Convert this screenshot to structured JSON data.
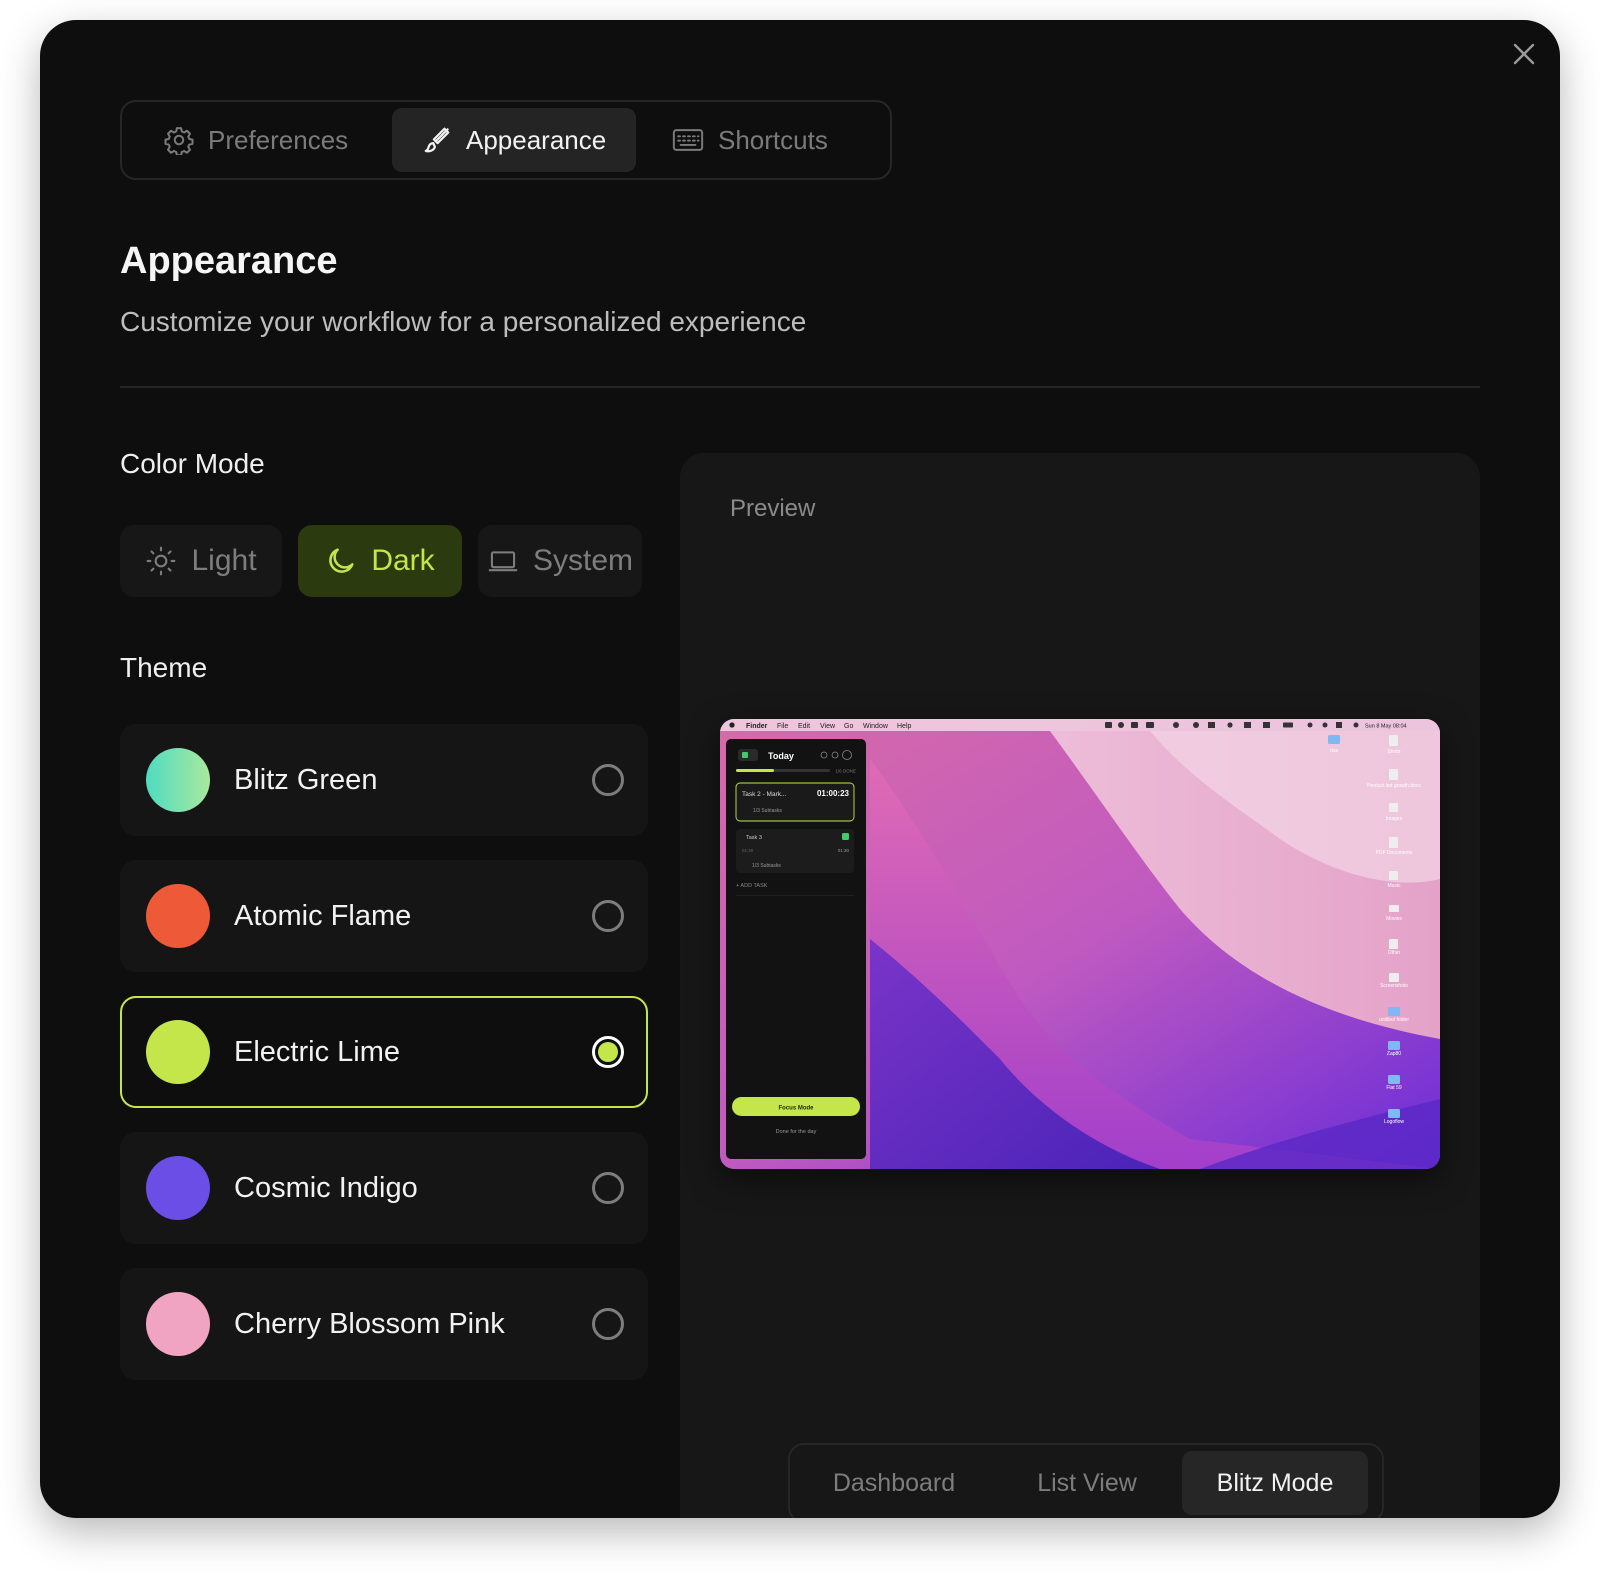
{
  "tabs": [
    {
      "label": "Preferences",
      "icon": "gear-icon"
    },
    {
      "label": "Appearance",
      "icon": "brush-icon"
    },
    {
      "label": "Shortcuts",
      "icon": "keyboard-icon"
    }
  ],
  "active_tab": "Appearance",
  "page": {
    "title": "Appearance",
    "subtitle": "Customize your workflow for a personalized experience"
  },
  "color_mode": {
    "label": "Color Mode",
    "options": [
      {
        "label": "Light",
        "icon": "sun-icon"
      },
      {
        "label": "Dark",
        "icon": "moon-icon"
      },
      {
        "label": "System",
        "icon": "laptop-icon"
      }
    ],
    "selected": "Dark"
  },
  "theme": {
    "label": "Theme",
    "options": [
      {
        "name": "Blitz Green",
        "color": "gradient #5ee0b5 → #a8e6a0"
      },
      {
        "name": "Atomic Flame",
        "color": "#ee5a37"
      },
      {
        "name": "Electric Lime",
        "color": "#c4e64a"
      },
      {
        "name": "Cosmic Indigo",
        "color": "#6b4ee6"
      },
      {
        "name": "Cherry Blossom Pink",
        "color": "#f0a4c2"
      }
    ],
    "selected": "Electric Lime"
  },
  "preview": {
    "label": "Preview",
    "menubar": {
      "items": [
        "Finder",
        "File",
        "Edit",
        "View",
        "Go",
        "Window",
        "Help"
      ],
      "clock": "Sun 8 May 08:04"
    },
    "app": {
      "title": "Today",
      "progress_text": "1/6 DONE",
      "progress": 0.33,
      "tasks": [
        {
          "name": "Task 2 - Mark...",
          "time": "01:00:23",
          "subtasks": "1/3 Subtasks"
        },
        {
          "name": "Task 3",
          "time_left": "01:30",
          "time_right": "01:30",
          "subtasks": "1/3 Subtasks"
        }
      ],
      "add_task": "+ ADD TASK",
      "focus_button": "Focus Mode",
      "done_link": "Done for the day"
    },
    "desktop_icons": [
      "dsa",
      "Shottr",
      "Product led growth.docx",
      "Images",
      "PDF Documents",
      "Music",
      "Movies",
      "Other",
      "Screenshots",
      "untitled folder",
      "Zap80",
      "Flat 59",
      "Logoflow"
    ]
  },
  "view_switch": {
    "options": [
      "Dashboard",
      "List View",
      "Blitz Mode"
    ],
    "selected": "Blitz Mode"
  },
  "colors": {
    "accent": "#c4e64a",
    "background": "#0e0e0e",
    "panel": "#171717"
  }
}
